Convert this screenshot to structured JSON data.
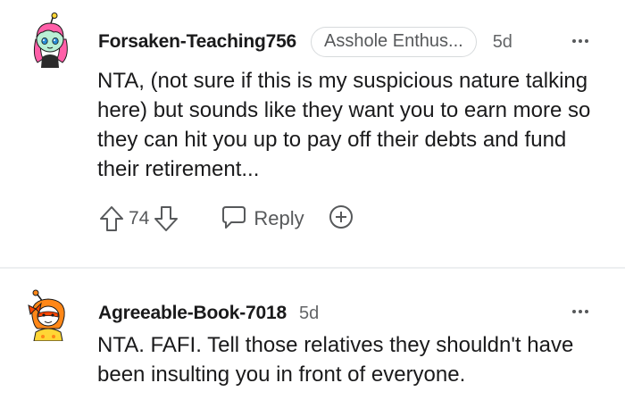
{
  "comments": [
    {
      "username": "Forsaken-Teaching756",
      "flair": "Asshole Enthus...",
      "time": "5d",
      "text": "NTA, (not sure if this is my suspicious nature talking here) but sounds like they want you to earn more so they can hit you up to pay off their debts and fund their retirement...",
      "score": "74",
      "reply_label": "Reply",
      "avatar": "pink-haired-avatar"
    },
    {
      "username": "Agreeable-Book-7018",
      "time": "5d",
      "text": "NTA. FAFI. Tell those relatives they shouldn't have been insulting you in front of everyone.",
      "avatar": "orange-haired-avatar"
    }
  ],
  "icons": {
    "upvote": "upvote-arrow-icon",
    "downvote": "downvote-arrow-icon",
    "reply": "speech-bubble-icon",
    "award": "plus-circle-icon",
    "more": "more-dots-icon"
  },
  "colors": {
    "text": "#1a1a1b",
    "muted": "#57595b",
    "divider": "#edeff1",
    "flair_border": "#d7dadc"
  }
}
